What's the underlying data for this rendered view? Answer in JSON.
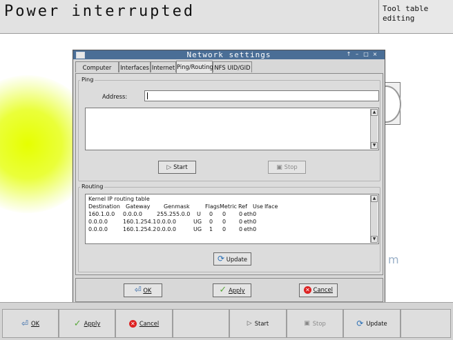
{
  "header": {
    "mode_title": "Power interrupted",
    "side_title": "Tool table\nediting"
  },
  "dialog": {
    "title": "Network settings",
    "title_buttons": [
      "↑",
      "–",
      "□",
      "×"
    ],
    "tabs": [
      {
        "label": "Computer name",
        "active": false
      },
      {
        "label": "Interfaces",
        "active": false
      },
      {
        "label": "Internet",
        "active": false
      },
      {
        "label": "Ping/Routing",
        "active": true
      },
      {
        "label": "NFS UID/GID",
        "active": false
      }
    ],
    "ping": {
      "group_label": "Ping",
      "address_label": "Address:",
      "address_value": "",
      "output_text": "",
      "start_label": "Start",
      "stop_label": "Stop"
    },
    "routing": {
      "group_label": "Routing",
      "table_title": "Kernel IP routing table",
      "columns": [
        "Destination",
        "Gateway",
        "Genmask",
        "Flags",
        "Metric",
        "Ref",
        "Use",
        "Iface"
      ],
      "rows": [
        [
          "160.1.0.0",
          "0.0.0.0",
          "255.255.0.0",
          "U",
          "0",
          "0",
          "0",
          "eth0"
        ],
        [
          "0.0.0.0",
          "160.1.254.1",
          "0.0.0.0",
          "UG",
          "0",
          "0",
          "0",
          "eth0"
        ],
        [
          "0.0.0.0",
          "160.1.254.2",
          "0.0.0.0",
          "UG",
          "1",
          "0",
          "0",
          "eth0"
        ]
      ],
      "update_label": "Update"
    },
    "buttons": {
      "ok": "OK",
      "apply": "Apply",
      "cancel": "Cancel"
    }
  },
  "softkeys": {
    "ok": "OK",
    "apply": "Apply",
    "cancel": "Cancel",
    "start": "Start",
    "stop": "Stop",
    "update": "Update"
  },
  "colors": {
    "titlebar": "#4a6e96",
    "highlight": "#e6ff00"
  }
}
